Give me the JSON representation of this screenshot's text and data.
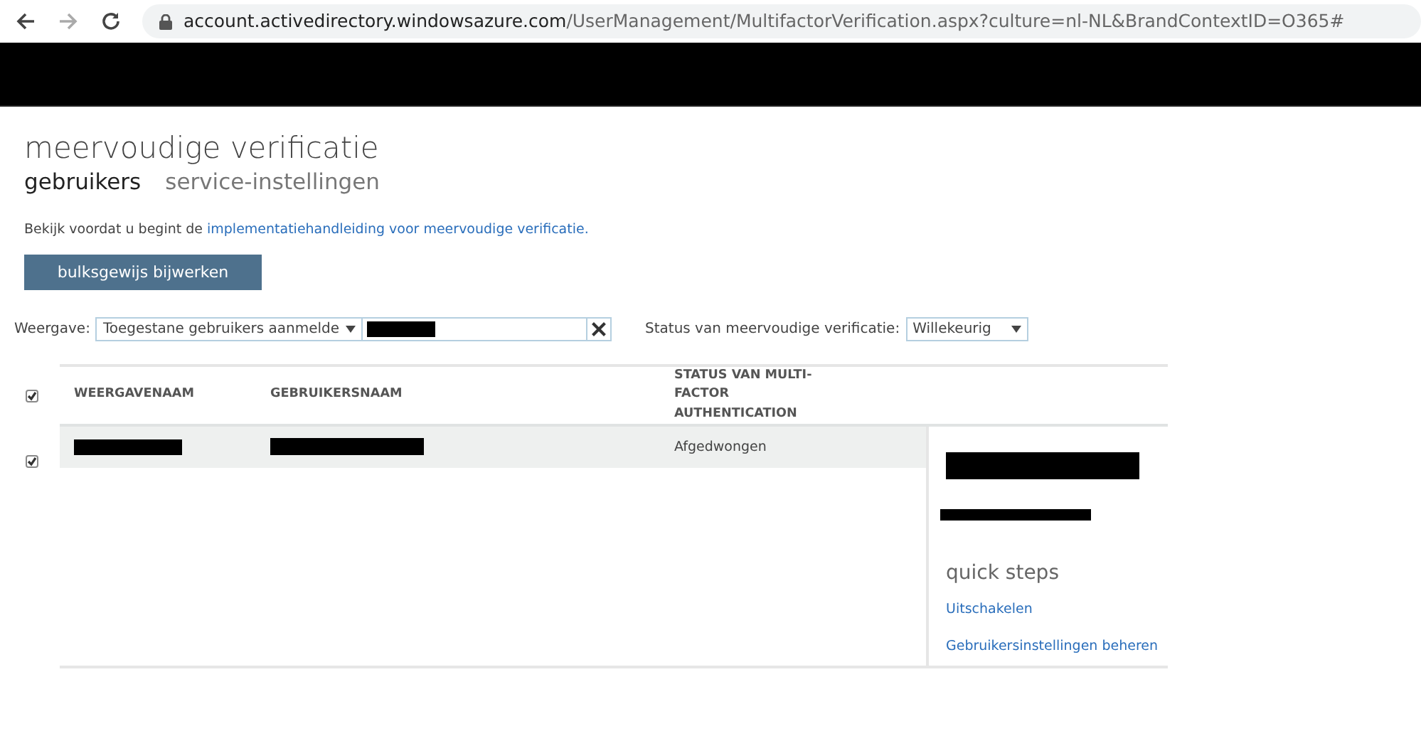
{
  "browser": {
    "url_host": "account.activedirectory.windowsazure.com",
    "url_path": "/UserManagement/MultifactorVerification.aspx?culture=nl-NL&BrandContextID=O365#"
  },
  "page": {
    "title": "meervoudige verificatie"
  },
  "tabs": [
    {
      "label": "gebruikers",
      "selected": true
    },
    {
      "label": "service-instellingen",
      "selected": false
    }
  ],
  "intro": {
    "text": "Bekijk voordat u begint de ",
    "link": "implementatiehandleiding voor meervoudige verificatie."
  },
  "bulk_button": "bulksgewijs bijwerken",
  "filters": {
    "view_label": "Weergave:",
    "view_value": "Toegestane gebruikers aanmelde",
    "status_label": "Status van meervoudige verificatie:",
    "status_value": "Willekeurig"
  },
  "table": {
    "select_all_checked": true,
    "columns": [
      "WEERGAVENAAM",
      "GEBRUIKERSNAAM",
      "STATUS VAN MULTI-FACTOR AUTHENTICATION"
    ],
    "rows": [
      {
        "checked": true,
        "selected": true,
        "status": "Afgedwongen"
      }
    ]
  },
  "details": {
    "quick_steps_title": "quick steps",
    "links": [
      "Uitschakelen",
      "Gebruikersinstellingen beheren"
    ]
  }
}
